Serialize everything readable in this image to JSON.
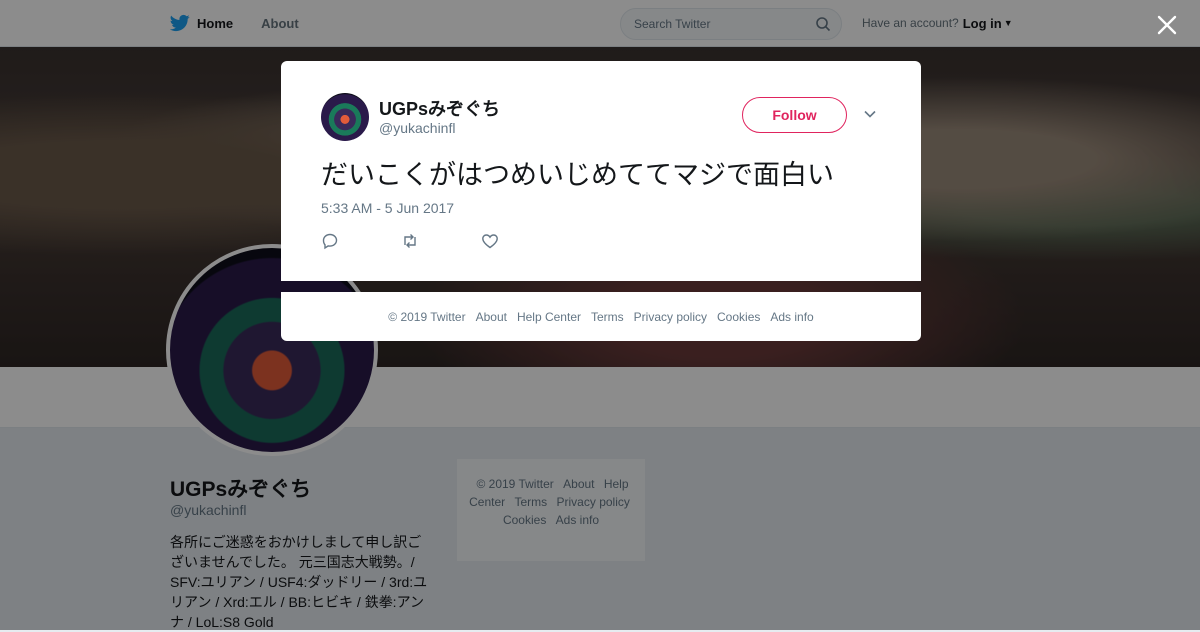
{
  "nav": {
    "home_label": "Home",
    "about_label": "About",
    "search_placeholder": "Search Twitter",
    "account_prompt": "Have an account?",
    "login_label": "Log in"
  },
  "profile": {
    "name": "UGPsみぞぐち",
    "handle": "@yukachinfl",
    "bio": "各所にご迷惑をおかけしまして申し訳ございませんでした。 元三国志大戦勢。/ SFV:ユリアン / USF4:ダッドリー / 3rd:ユリアン / Xrd:エル / BB:ヒビキ / 鉄拳:アンナ / LoL:S8 Gold"
  },
  "side_footer": {
    "links": [
      "© 2019 Twitter",
      "About",
      "Help Center",
      "Terms",
      "Privacy policy",
      "Cookies",
      "Ads info"
    ]
  },
  "tweet": {
    "name": "UGPsみぞぐち",
    "handle": "@yukachinfl",
    "follow_label": "Follow",
    "text": "だいこくがはつめいじめててマジで面白い",
    "timestamp": "5:33 AM - 5 Jun 2017"
  },
  "modal_footer": {
    "links": [
      "© 2019 Twitter",
      "About",
      "Help Center",
      "Terms",
      "Privacy policy",
      "Cookies",
      "Ads info"
    ]
  },
  "colors": {
    "twitter_blue": "#1da1f2",
    "follow_accent": "#e0245e",
    "secondary_text": "#657786"
  },
  "icons": [
    "twitter-bird-icon",
    "search-icon",
    "caret-down-icon",
    "close-icon",
    "chevron-down-icon",
    "reply-icon",
    "retweet-icon",
    "like-icon"
  ]
}
